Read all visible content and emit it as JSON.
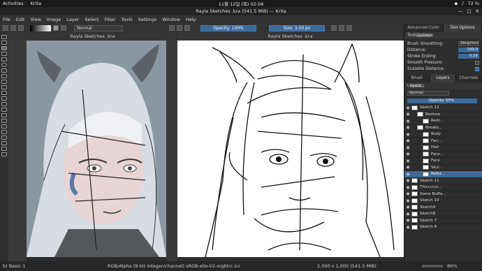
{
  "top": {
    "activities": "Activities",
    "app": "Krita",
    "clock": "11월 12일 (목) 02:04",
    "battery": "72 %"
  },
  "title": "Rayla Sketches .kra (541.5 MiB) — Krita",
  "menu": [
    "File",
    "Edit",
    "View",
    "Image",
    "Layer",
    "Select",
    "Filter",
    "Tools",
    "Settings",
    "Window",
    "Help"
  ],
  "toolbar": {
    "blend": "Normal",
    "opacity": "Opacity: 100%",
    "size": "Size: 3.00 px"
  },
  "views": [
    "Rayla Sketches .kra",
    "Rayla Sketches .kra"
  ],
  "rightpanel": {
    "tabs_top": [
      "Advanced Color Selector",
      "Tool Options"
    ],
    "tool_options_title": "Tool Options",
    "brush_smoothing_label": "Brush Smoothing:",
    "brush_smoothing_value": "Weighted",
    "distance_label": "Distance:",
    "distance_value": "100.0",
    "stroke_ending_label": "Stroke Ending:",
    "stroke_ending_value": "0.15",
    "smooth_pressure_label": "Smooth Pressure:",
    "scalable_distance_label": "Scalable Distance:",
    "tabs_mid": [
      "Brush Presets",
      "Layers",
      "Channels"
    ],
    "layers_title": "Layers",
    "layer_blend": "Normal",
    "layer_opacity": "Opacity:  55%",
    "layers": [
      {
        "name": "Sketch 12",
        "indent": 0
      },
      {
        "name": "Redraw",
        "indent": 1
      },
      {
        "name": "Redr...",
        "indent": 2
      },
      {
        "name": "Breako...",
        "indent": 1
      },
      {
        "name": "Body",
        "indent": 2
      },
      {
        "name": "Faci...",
        "indent": 2
      },
      {
        "name": "Hair",
        "indent": 2
      },
      {
        "name": "Face...",
        "indent": 2
      },
      {
        "name": "Face",
        "indent": 2
      },
      {
        "name": "Skul...",
        "indent": 2
      },
      {
        "name": "Refer...",
        "indent": 2,
        "selected": true
      },
      {
        "name": "Sketch 11",
        "indent": 0
      },
      {
        "name": "Thicccccc...",
        "indent": 0
      },
      {
        "name": "Some Buffa...",
        "indent": 0
      },
      {
        "name": "Sketch 10",
        "indent": 0
      },
      {
        "name": "Sketch9",
        "indent": 0
      },
      {
        "name": "Sketch8",
        "indent": 0
      },
      {
        "name": "Sketch 7",
        "indent": 0
      },
      {
        "name": "Sketch 6",
        "indent": 0
      }
    ]
  },
  "status": {
    "brush": "b) Basic-1",
    "colorspace": "RGB/Alpha (8-bit integer/channel)  sRGB-elle-V2-srgbtrc.icc",
    "dimensions": "2,000 x 1,000 (541.5 MiB)",
    "zoom": "86%"
  }
}
